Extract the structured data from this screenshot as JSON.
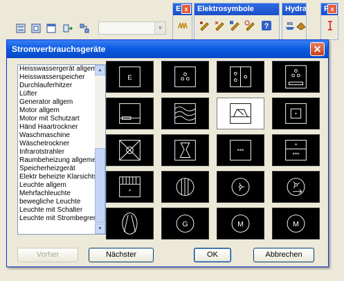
{
  "toolbars": {
    "e_toolbar": {
      "title": "E"
    },
    "elektro": {
      "title": "Elektrosymbole"
    },
    "hydra": {
      "title": "Hydra"
    },
    "p": {
      "title": "P"
    }
  },
  "dialog": {
    "title": "Stromverbrauchsgeräte",
    "list_items": [
      "Heisswassergerät allgemein",
      "Heisswasserspeicher",
      "Durchlauferhitzer",
      "Lüfter",
      "Generator allgem",
      "Motor allgem",
      "Motor mit Schutzart",
      "Händ Haartrockner",
      "Waschmaschine",
      "Wäschetrockner",
      "Infrarotstrahler",
      "Raumbeheizung allgemein",
      "Speicherheizgerät",
      "Elektr beheizte Klarsichtscheibe",
      "Leuchte allgem",
      "Mehrfachleuchte",
      "bewegliche Leuchte",
      "Leuchte mit Schalter",
      "Leuchte mit Strombegrenzer"
    ],
    "buttons": {
      "prev": "Vorher",
      "next": "Nächster",
      "ok": "OK",
      "cancel": "Abbrechen"
    },
    "symbols": [
      {
        "name": "symbol-e-text",
        "label": "E"
      },
      {
        "name": "symbol-three-dots"
      },
      {
        "name": "symbol-split-dots"
      },
      {
        "name": "symbol-dots-bar"
      },
      {
        "name": "symbol-box-bar"
      },
      {
        "name": "symbol-waves"
      },
      {
        "name": "symbol-hood"
      },
      {
        "name": "symbol-square-dot"
      },
      {
        "name": "symbol-diamond-circle"
      },
      {
        "name": "symbol-hourglass"
      },
      {
        "name": "symbol-stars",
        "label": "***"
      },
      {
        "name": "symbol-star-stars",
        "label": "*",
        "label2": "***"
      },
      {
        "name": "symbol-hatched-star",
        "label": "*"
      },
      {
        "name": "symbol-striped-circle"
      },
      {
        "name": "symbol-circle-fan"
      },
      {
        "name": "symbol-circle-fan-arrow"
      },
      {
        "name": "symbol-circle-lines"
      },
      {
        "name": "symbol-generator",
        "label": "G"
      },
      {
        "name": "symbol-motor",
        "label": "M"
      },
      {
        "name": "symbol-motor-2",
        "label": "M"
      }
    ],
    "selected_index": 6
  }
}
